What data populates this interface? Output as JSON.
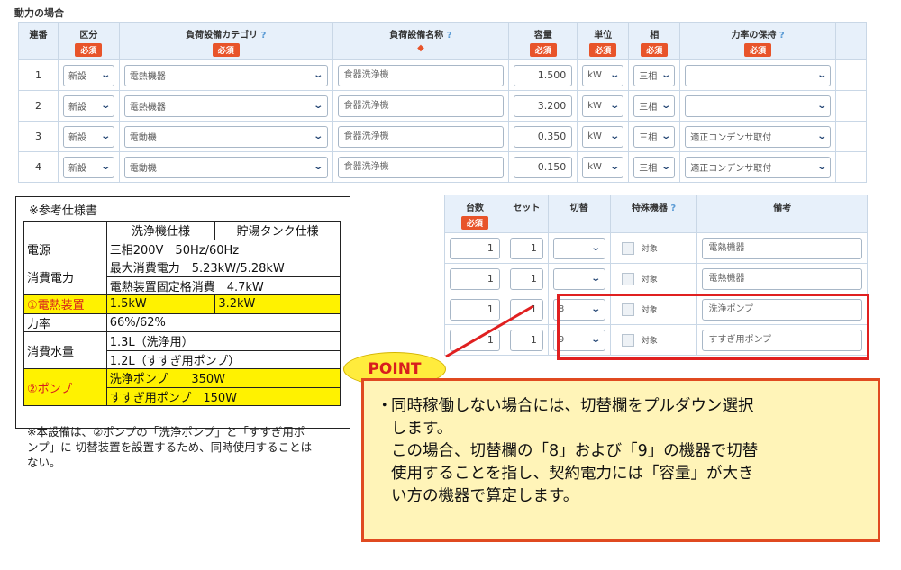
{
  "section_title": "動力の場合",
  "headers": {
    "no": "連番",
    "kubun": "区分",
    "category": "負荷設備カテゴリ",
    "name": "負荷設備名称",
    "capacity": "容量",
    "unit": "単位",
    "phase": "相",
    "power_factor": "力率の保持",
    "required": "必須",
    "help": "?",
    "name_mark": "◆"
  },
  "rows": [
    {
      "no": "1",
      "kubun": "新設",
      "category": "電熱機器",
      "name": "食器洗浄機",
      "capacity": "1.500",
      "unit": "kW",
      "phase": "三相",
      "power_factor": ""
    },
    {
      "no": "2",
      "kubun": "新設",
      "category": "電熱機器",
      "name": "食器洗浄機",
      "capacity": "3.200",
      "unit": "kW",
      "phase": "三相",
      "power_factor": ""
    },
    {
      "no": "3",
      "kubun": "新設",
      "category": "電動機",
      "name": "食器洗浄機",
      "capacity": "0.350",
      "unit": "kW",
      "phase": "三相",
      "power_factor": "適正コンデンサ取付"
    },
    {
      "no": "4",
      "kubun": "新設",
      "category": "電動機",
      "name": "食器洗浄機",
      "capacity": "0.150",
      "unit": "kW",
      "phase": "三相",
      "power_factor": "適正コンデンサ取付"
    }
  ],
  "sub_headers": {
    "count": "台数",
    "set": "セット",
    "switch": "切替",
    "special": "特殊機器",
    "remarks": "備考",
    "required": "必須",
    "help": "?"
  },
  "sub_rows": [
    {
      "count": "1",
      "set": "1",
      "switch": "",
      "target": "対象",
      "remarks": "電熱機器"
    },
    {
      "count": "1",
      "set": "1",
      "switch": "",
      "target": "対象",
      "remarks": "電熱機器"
    },
    {
      "count": "1",
      "set": "1",
      "switch": "8",
      "target": "対象",
      "remarks": "洗浄ポンプ"
    },
    {
      "count": "1",
      "set": "1",
      "switch": "9",
      "target": "対象",
      "remarks": "すすぎ用ポンプ"
    }
  ],
  "spec": {
    "title": "※参考仕様書",
    "col1": "洗浄機仕様",
    "col2": "貯湯タンク仕様",
    "power_source_label": "電源",
    "power_source_value": "三相200V　50Hz/60Hz",
    "consumption_label": "消費電力",
    "consumption_max": "最大消費電力　5.23kW/5.28kW",
    "consumption_heater": "電熱装置固定格消費　4.7kW",
    "heater_label": "①電熱装置",
    "heater_v1": "1.5kW",
    "heater_v2": "3.2kW",
    "pf_label": "力率",
    "pf_value": "66%/62%",
    "water_label": "消費水量",
    "water_1": "1.3L（洗浄用）",
    "water_2": "1.2L（すすぎ用ポンプ）",
    "pump_label": "②ポンプ",
    "pump_1": "洗浄ポンプ　　350W",
    "pump_2": "すすぎ用ポンプ　150W"
  },
  "note": "※本設備は、②ポンプの「洗浄ポンプ」と「すすぎ用ポンプ」に 切替装置を設置するため、同時使用することはない。",
  "point_label": "POINT",
  "explain": {
    "bullet": "・",
    "line1": "同時稼働しない場合には、切替欄をプルダウン選択",
    "line2": "します。",
    "line3": "この場合、切替欄の「8」および「9」の機器で切替",
    "line4": "使用することを指し、契約電力には「容量」が大き",
    "line5": "い方の機器で算定します。"
  },
  "colors": {
    "header_bg": "#e7f0fa",
    "required_badge": "#e8542a",
    "highlight_yellow": "#fff200",
    "alert_red": "#e02020",
    "point_bubble": "#ffec3d",
    "explain_bg": "#fff4b8"
  }
}
